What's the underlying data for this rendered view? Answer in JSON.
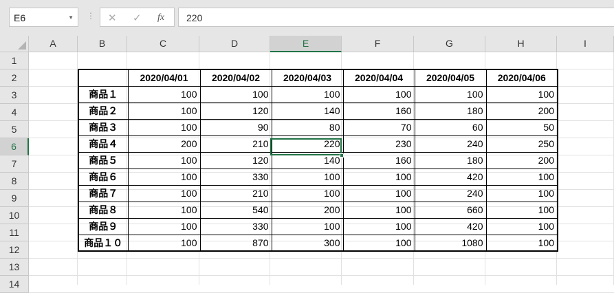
{
  "formula_bar": {
    "name_box": "E6",
    "dropdown_glyph": "▼",
    "separator_glyph": "⋮",
    "cancel_glyph": "✕",
    "enter_glyph": "✓",
    "fx_glyph": "fx",
    "formula_value": "220"
  },
  "columns": [
    "A",
    "B",
    "C",
    "D",
    "E",
    "F",
    "G",
    "H",
    "I"
  ],
  "rows": [
    "1",
    "2",
    "3",
    "4",
    "5",
    "6",
    "7",
    "8",
    "9",
    "10",
    "11",
    "12",
    "13",
    "14"
  ],
  "selected": {
    "column": "E",
    "row": "6"
  },
  "table": {
    "headers": [
      "",
      "2020/04/01",
      "2020/04/02",
      "2020/04/03",
      "2020/04/04",
      "2020/04/05",
      "2020/04/06"
    ],
    "rows": [
      {
        "name": "商品１",
        "values": [
          "100",
          "100",
          "100",
          "100",
          "100",
          "100"
        ]
      },
      {
        "name": "商品２",
        "values": [
          "100",
          "120",
          "140",
          "160",
          "180",
          "200"
        ]
      },
      {
        "name": "商品３",
        "values": [
          "100",
          "90",
          "80",
          "70",
          "60",
          "50"
        ]
      },
      {
        "name": "商品４",
        "values": [
          "200",
          "210",
          "220",
          "230",
          "240",
          "250"
        ]
      },
      {
        "name": "商品５",
        "values": [
          "100",
          "120",
          "140",
          "160",
          "180",
          "200"
        ]
      },
      {
        "name": "商品６",
        "values": [
          "100",
          "330",
          "100",
          "100",
          "420",
          "100"
        ]
      },
      {
        "name": "商品７",
        "values": [
          "100",
          "210",
          "100",
          "100",
          "240",
          "100"
        ]
      },
      {
        "name": "商品８",
        "values": [
          "100",
          "540",
          "200",
          "100",
          "660",
          "100"
        ]
      },
      {
        "name": "商品９",
        "values": [
          "100",
          "330",
          "100",
          "100",
          "420",
          "100"
        ]
      },
      {
        "name": "商品１０",
        "values": [
          "100",
          "870",
          "300",
          "100",
          "1080",
          "100"
        ]
      }
    ]
  },
  "colors": {
    "accent": "#217346",
    "header_bg": "#e6e6e6"
  }
}
